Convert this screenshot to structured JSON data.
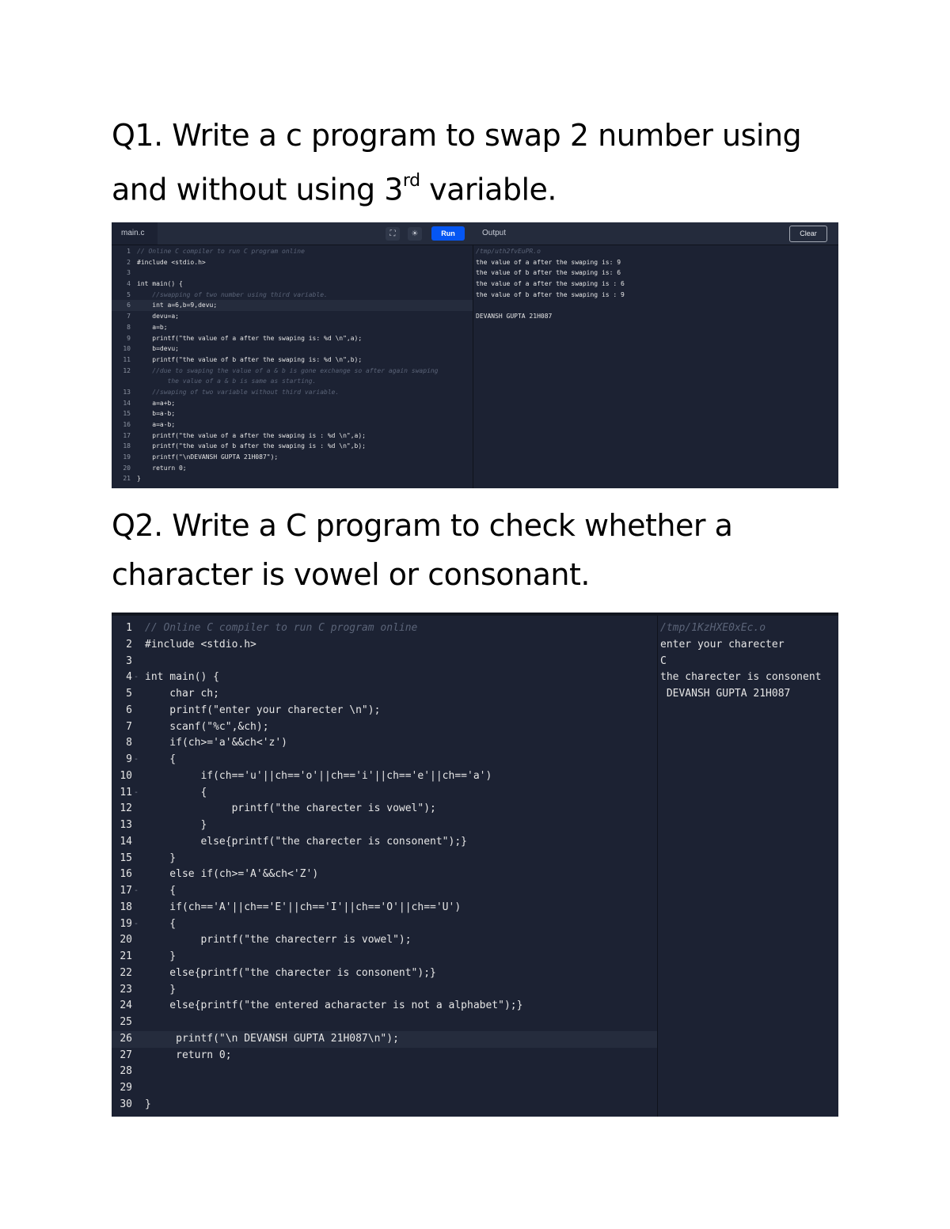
{
  "q1": {
    "text_before": "Q1. Write a c program to swap 2 number using and without using 3",
    "superscript": "rd",
    "text_after": " variable."
  },
  "q2": {
    "text": "Q2. Write a C program to check whether a character is vowel or consonant."
  },
  "screenshot1": {
    "tab_label": "main.c",
    "run_label": "Run",
    "output_title": "Output",
    "clear_label": "Clear",
    "icons": [
      "fullscreen-icon",
      "theme-sun-icon"
    ],
    "code_lines": [
      {
        "n": "1",
        "text": "// Online C compiler to run C program online"
      },
      {
        "n": "2",
        "text": "#include <stdio.h>"
      },
      {
        "n": "3",
        "text": ""
      },
      {
        "n": "4",
        "text": "int main() {"
      },
      {
        "n": "5",
        "text": "    //swapping of two number using third variable."
      },
      {
        "n": "6",
        "text": "    int a=6,b=9,devu;"
      },
      {
        "n": "7",
        "text": "    devu=a;"
      },
      {
        "n": "8",
        "text": "    a=b;"
      },
      {
        "n": "9",
        "text": "    printf(\"the value of a after the swaping is: %d \\n\",a);"
      },
      {
        "n": "10",
        "text": "    b=devu;"
      },
      {
        "n": "11",
        "text": "    printf(\"the value of b after the swaping is: %d \\n\",b);"
      },
      {
        "n": "12",
        "text": "    //due to swaping the value of a & b is gone exchange so after again swaping"
      },
      {
        "n": "",
        "text": "        the value of a & b is same as starting."
      },
      {
        "n": "13",
        "text": "    //swaping of two variable without third variable."
      },
      {
        "n": "14",
        "text": "    a=a+b;"
      },
      {
        "n": "15",
        "text": "    b=a-b;"
      },
      {
        "n": "16",
        "text": "    a=a-b;"
      },
      {
        "n": "17",
        "text": "    printf(\"the value of a after the swaping is : %d \\n\",a);"
      },
      {
        "n": "18",
        "text": "    printf(\"the value of b after the swaping is : %d \\n\",b);"
      },
      {
        "n": "19",
        "text": "    printf(\"\\nDEVANSH GUPTA 21H087\");"
      },
      {
        "n": "20",
        "text": "    return 0;"
      },
      {
        "n": "21",
        "text": "}"
      }
    ],
    "output_lines": [
      "/tmp/uth2fvEuPR.o",
      "the value of a after the swaping is: 9",
      "the value of b after the swaping is: 6",
      "the value of a after the swaping is : 6",
      "the value of b after the swaping is : 9",
      "",
      "DEVANSH GUPTA 21H087"
    ]
  },
  "screenshot2": {
    "code_lines": [
      {
        "n": "1",
        "text": "// Online C compiler to run C program online"
      },
      {
        "n": "2",
        "text": "#include <stdio.h>"
      },
      {
        "n": "3",
        "text": ""
      },
      {
        "n": "4",
        "text": "int main() {"
      },
      {
        "n": "5",
        "text": "    char ch;"
      },
      {
        "n": "6",
        "text": "    printf(\"enter your charecter \\n\");"
      },
      {
        "n": "7",
        "text": "    scanf(\"%c\",&ch);"
      },
      {
        "n": "8",
        "text": "    if(ch>='a'&&ch<'z')"
      },
      {
        "n": "9",
        "text": "    {"
      },
      {
        "n": "10",
        "text": "         if(ch=='u'||ch=='o'||ch=='i'||ch=='e'||ch=='a')"
      },
      {
        "n": "11",
        "text": "         {"
      },
      {
        "n": "12",
        "text": "              printf(\"the charecter is vowel\");"
      },
      {
        "n": "13",
        "text": "         }"
      },
      {
        "n": "14",
        "text": "         else{printf(\"the charecter is consonent\");}"
      },
      {
        "n": "15",
        "text": "    }"
      },
      {
        "n": "16",
        "text": "    else if(ch>='A'&&ch<'Z')"
      },
      {
        "n": "17",
        "text": "    {"
      },
      {
        "n": "18",
        "text": "    if(ch=='A'||ch=='E'||ch=='I'||ch=='O'||ch=='U')"
      },
      {
        "n": "19",
        "text": "    {"
      },
      {
        "n": "20",
        "text": "         printf(\"the charecterr is vowel\");"
      },
      {
        "n": "21",
        "text": "    }"
      },
      {
        "n": "22",
        "text": "    else{printf(\"the charecter is consonent\");}"
      },
      {
        "n": "23",
        "text": "    }"
      },
      {
        "n": "24",
        "text": "    else{printf(\"the entered acharacter is not a alphabet\");}"
      },
      {
        "n": "25",
        "text": ""
      },
      {
        "n": "26",
        "text": "     printf(\"\\n DEVANSH GUPTA 21H087\\n\");"
      },
      {
        "n": "27",
        "text": "     return 0;"
      },
      {
        "n": "28",
        "text": ""
      },
      {
        "n": "29",
        "text": ""
      },
      {
        "n": "30",
        "text": "}"
      }
    ],
    "fold_markers": [
      "4",
      "9",
      "11",
      "17",
      "19"
    ],
    "output_lines": [
      "/tmp/1KzHXE0xEc.o",
      "enter your charecter",
      "C",
      "the charecter is consonent",
      " DEVANSH GUPTA 21H087"
    ]
  }
}
